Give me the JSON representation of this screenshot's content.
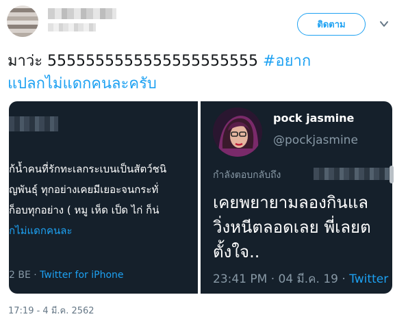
{
  "header": {
    "follow_label": "ติดตาม"
  },
  "tweet": {
    "text_line1_plain": "มาว่ะ 5555555555555555555555",
    "hashtag_line1": "#อยาก",
    "hashtag_line2": "แปลกไม่แดกคนละครับ"
  },
  "embed_left": {
    "lines": [
      "ก้น้ำคนที่รักทะเลกระเบนเป็นสัตว์ชนิ",
      "ญพันธุ์ ทุกอย่างเคยมีเยอะจนกระทั่",
      "ก็อบทุกอย่าง ( หมู เห็ด เป็ด ไก่ ก็น่"
    ],
    "link_line": "กไม่แดกคนละ",
    "meta_prefix": "2 BE · ",
    "meta_source": "Twitter for iPhone"
  },
  "embed_right": {
    "name": "pock jasmine",
    "handle": "@pockjasmine",
    "reply_label": "กำลังตอบกลับถึง",
    "body_lines": [
      "เคยพยายามลองกินแล",
      "วิ่งหนีตลอดเลย พี่เลยต",
      "ตั้งใจ.."
    ],
    "meta_time": "23:41 PM · 04 มี.ค. 19 · ",
    "meta_source": "Twitter"
  },
  "footer": {
    "timestamp": "17:19 - 4 มี.ค. 2562"
  },
  "colors": {
    "accent": "#1da1f2",
    "panel_bg": "#15202b",
    "muted": "#8899a6"
  }
}
